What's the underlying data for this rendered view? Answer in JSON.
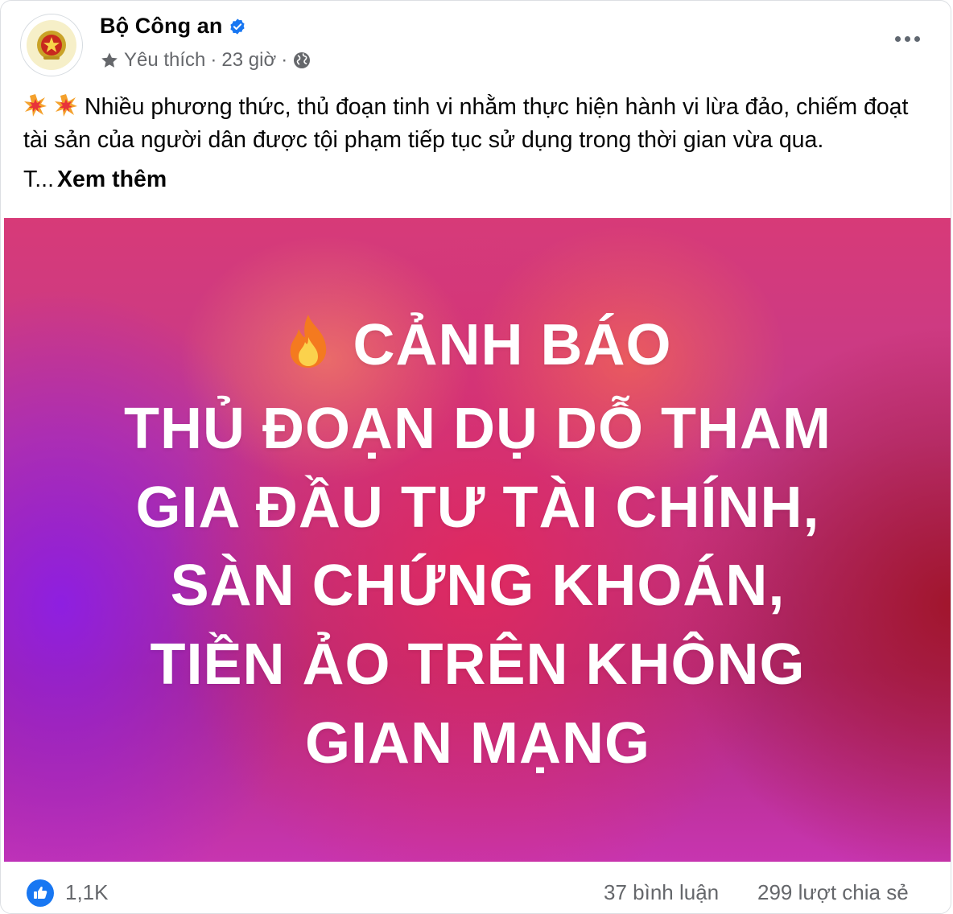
{
  "header": {
    "page_name": "Bộ Công an",
    "follow_status": "Yêu thích",
    "separator": "·",
    "time": "23 giờ",
    "more_icon": "more-horizontal-icon"
  },
  "post": {
    "body": "Nhiều phương thức, thủ đoạn tinh vi nhằm thực hiện hành vi lừa đảo, chiếm đoạt tài sản của người dân được tội phạm tiếp tục sử dụng trong thời gian vừa qua.",
    "truncated": "T...",
    "see_more": "Xem thêm"
  },
  "banner": {
    "line1": "CẢNH BÁO",
    "line2": "THỦ ĐOẠN DỤ DỖ THAM",
    "line3": "GIA ĐẦU TƯ TÀI CHÍNH,",
    "line4": "SÀN CHỨNG KHOÁN,",
    "line5": "TIỀN ẢO TRÊN KHÔNG",
    "line6": "GIAN MẠNG"
  },
  "footer": {
    "likes": "1,1K",
    "comments": "37 bình luận",
    "shares": "299 lượt chia sẻ"
  },
  "colors": {
    "brand_blue": "#1877f2",
    "muted_text": "#65676b"
  }
}
